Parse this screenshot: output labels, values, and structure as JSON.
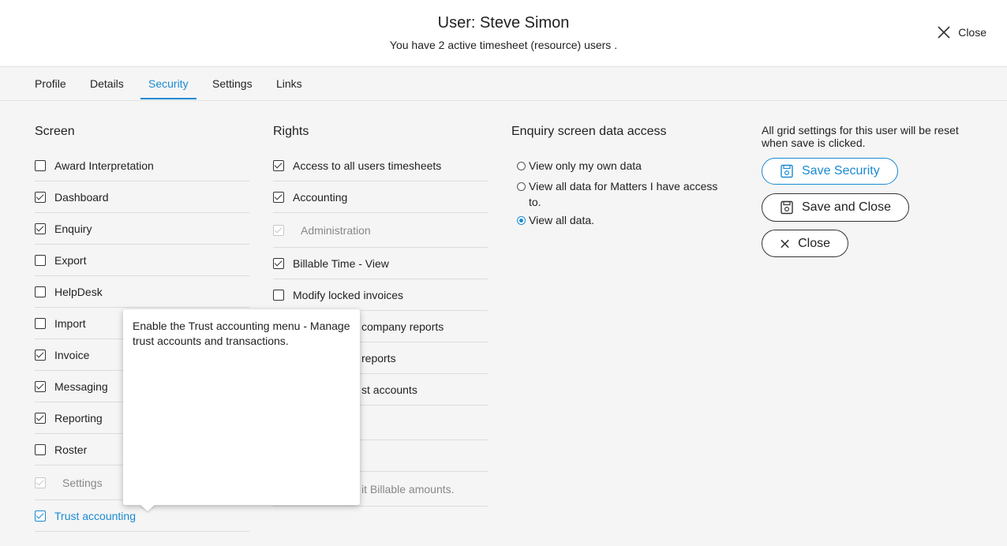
{
  "header": {
    "title": "User: Steve Simon",
    "subtitle": "You have 2 active timesheet (resource) users .",
    "close_label": "Close"
  },
  "tabs": [
    {
      "label": "Profile",
      "active": false
    },
    {
      "label": "Details",
      "active": false
    },
    {
      "label": "Security",
      "active": true
    },
    {
      "label": "Settings",
      "active": false
    },
    {
      "label": "Links",
      "active": false
    }
  ],
  "screen": {
    "title": "Screen",
    "items": [
      {
        "label": "Award Interpretation",
        "checked": false
      },
      {
        "label": "Dashboard",
        "checked": true
      },
      {
        "label": "Enquiry",
        "checked": true
      },
      {
        "label": "Export",
        "checked": false
      },
      {
        "label": "HelpDesk",
        "checked": false
      },
      {
        "label": "Import",
        "checked": false
      },
      {
        "label": "Invoice",
        "checked": true
      },
      {
        "label": "Messaging",
        "checked": true
      },
      {
        "label": "Reporting",
        "checked": true
      },
      {
        "label": "Roster",
        "checked": false
      },
      {
        "label": "Settings",
        "checked": true,
        "disabled": true
      },
      {
        "label": "Trust accounting",
        "checked": true,
        "highlighted": true
      }
    ]
  },
  "rights": {
    "title": "Rights",
    "items": [
      {
        "label": "Access to all users timesheets",
        "checked": true
      },
      {
        "label": "Accounting",
        "checked": true
      },
      {
        "label": "Administration",
        "checked": true,
        "disabled": true
      },
      {
        "label": "Billable Time - View",
        "checked": true
      },
      {
        "label": "Modify locked invoices",
        "checked": false
      },
      {
        "label": "company reports",
        "checked": false
      },
      {
        "label": "reports",
        "checked": false
      },
      {
        "label": "st accounts",
        "checked": false
      },
      {
        "label": "",
        "checked": false
      },
      {
        "label": "",
        "checked": false
      },
      {
        "label": "it Billable amounts.",
        "checked": false,
        "disabled": true
      }
    ]
  },
  "enquiry": {
    "title": "Enquiry screen data access",
    "options": [
      {
        "label": "View only my own data",
        "selected": false
      },
      {
        "label": "View all data for Matters I have access to.",
        "selected": false
      },
      {
        "label": "View all data.",
        "selected": true
      }
    ]
  },
  "actions": {
    "note": "All grid settings for this user will be reset when save is clicked.",
    "save_security": "Save Security",
    "save_and_close": "Save and Close",
    "close": "Close"
  },
  "tooltip": {
    "text": "Enable the Trust accounting menu - Manage trust accounts and transactions."
  },
  "colors": {
    "accent": "#1b8ad3",
    "background": "#f5f5f5"
  }
}
